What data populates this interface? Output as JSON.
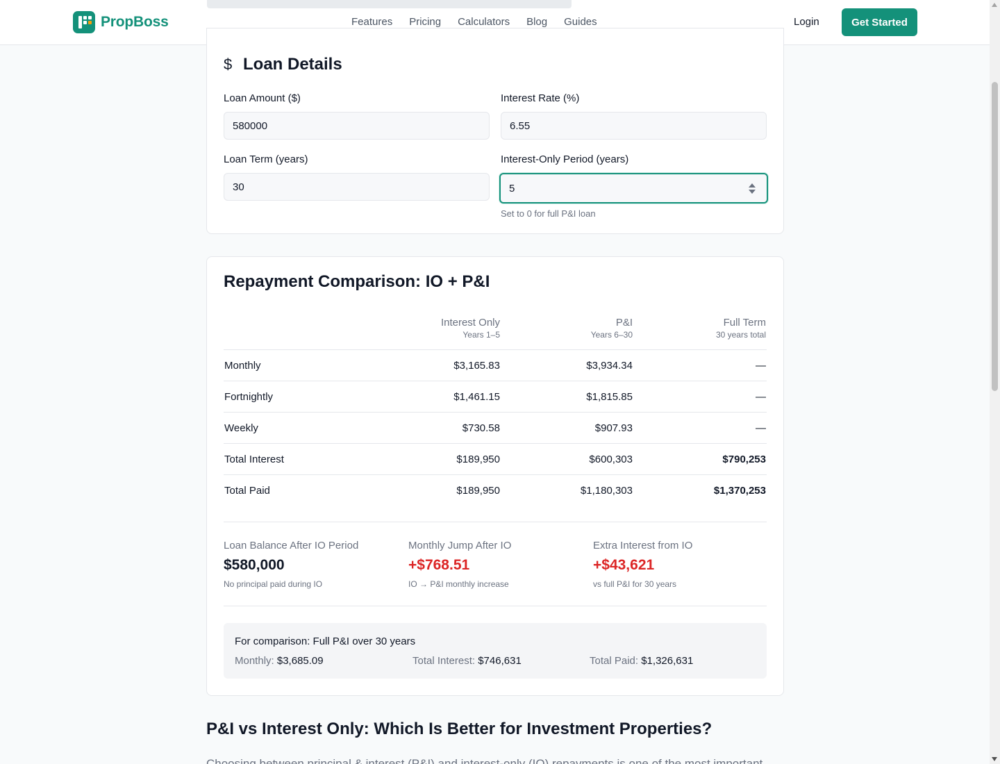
{
  "header": {
    "brand": "PropBoss",
    "nav": [
      "Features",
      "Pricing",
      "Calculators",
      "Blog",
      "Guides"
    ],
    "login": "Login",
    "cta": "Get Started"
  },
  "loan": {
    "title": "Loan Details",
    "icon": "dollar-icon",
    "amount": {
      "label": "Loan Amount ($)",
      "value": "580000"
    },
    "rate": {
      "label": "Interest Rate (%)",
      "value": "6.55"
    },
    "term": {
      "label": "Loan Term (years)",
      "value": "30"
    },
    "io": {
      "label": "Interest-Only Period (years)",
      "value": "5",
      "hint": "Set to 0 for full P&I loan"
    }
  },
  "repayment": {
    "title": "Repayment Comparison: IO + P&I",
    "columns": [
      {
        "header": "Interest Only",
        "sub": "Years 1–5"
      },
      {
        "header": "P&I",
        "sub": "Years 6–30"
      },
      {
        "header": "Full Term",
        "sub": "30 years total"
      }
    ],
    "rows": [
      {
        "label": "Monthly",
        "io": "$3,165.83",
        "pi": "$3,934.34",
        "full": "—"
      },
      {
        "label": "Fortnightly",
        "io": "$1,461.15",
        "pi": "$1,815.85",
        "full": "—"
      },
      {
        "label": "Weekly",
        "io": "$730.58",
        "pi": "$907.93",
        "full": "—"
      },
      {
        "label": "Total Interest",
        "io": "$189,950",
        "pi": "$600,303",
        "full": "$790,253"
      },
      {
        "label": "Total Paid",
        "io": "$189,950",
        "pi": "$1,180,303",
        "full": "$1,370,253"
      }
    ],
    "stats": [
      {
        "label": "Loan Balance After IO Period",
        "value": "$580,000",
        "sub": "No principal paid during IO"
      },
      {
        "label": "Monthly Jump After IO",
        "value": "+$768.51",
        "sub": "IO → P&I monthly increase"
      },
      {
        "label": "Extra Interest from IO",
        "value": "+$43,621",
        "sub": "vs full P&I for 30 years"
      }
    ],
    "comparison": {
      "title": "For comparison: Full P&I over 30 years",
      "monthly_label": "Monthly:",
      "monthly": "$3,685.09",
      "interest_label": "Total Interest:",
      "interest": "$746,631",
      "paid_label": "Total Paid:",
      "paid": "$1,326,631"
    }
  },
  "article": {
    "heading": "P&I vs Interest Only: Which Is Better for Investment Properties?",
    "intro": "Choosing between principal & interest (P&I) and interest-only (IO) repayments is one of the most important"
  },
  "colors": {
    "brand": "#14917a",
    "negative": "#dc2626"
  }
}
